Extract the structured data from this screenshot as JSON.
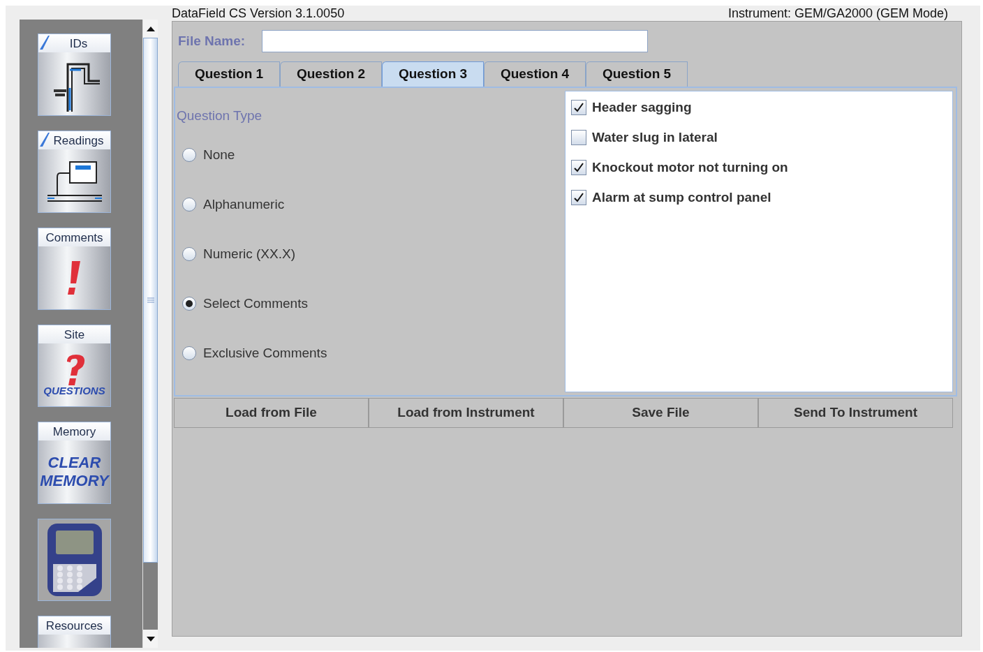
{
  "header": {
    "title": "DataField CS Version 3.1.0050",
    "instrument": "Instrument: GEM/GA2000 (GEM Mode)"
  },
  "sidebar": {
    "items": [
      {
        "kind": "pipes",
        "label": "IDs",
        "checked": true
      },
      {
        "kind": "meter",
        "label": "Readings",
        "checked": true
      },
      {
        "kind": "exclaim",
        "label": "Comments",
        "checked": false
      },
      {
        "kind": "question",
        "label": "Site",
        "checked": false,
        "image_text": [
          "QUESTIONS"
        ]
      },
      {
        "kind": "memory",
        "label": "Memory",
        "checked": false,
        "image_text": [
          "CLEAR",
          "MEMORY"
        ]
      },
      {
        "kind": "device"
      },
      {
        "kind": "partial",
        "label": "Resources",
        "checked": false
      }
    ]
  },
  "file_name": {
    "label": "File Name:"
  },
  "tabs": [
    {
      "label": "Question 1",
      "selected": false
    },
    {
      "label": "Question 2",
      "selected": false
    },
    {
      "label": "Question 3",
      "selected": true
    },
    {
      "label": "Question 4",
      "selected": false
    },
    {
      "label": "Question 5",
      "selected": false
    }
  ],
  "question_type": {
    "label": "Question Type",
    "options": [
      {
        "label": "None",
        "selected": false
      },
      {
        "label": "Alphanumeric",
        "selected": false
      },
      {
        "label": "Numeric (XX.X)",
        "selected": false
      },
      {
        "label": "Select Comments",
        "selected": true
      },
      {
        "label": "Exclusive Comments",
        "selected": false
      }
    ]
  },
  "comments": [
    {
      "label": "Header sagging",
      "checked": true
    },
    {
      "label": "Water slug in lateral",
      "checked": false
    },
    {
      "label": "Knockout motor not turning on",
      "checked": true
    },
    {
      "label": "Alarm at sump control panel",
      "checked": true
    }
  ],
  "buttons": [
    "Load from File",
    "Load from Instrument",
    "Save File",
    "Send To Instrument"
  ]
}
